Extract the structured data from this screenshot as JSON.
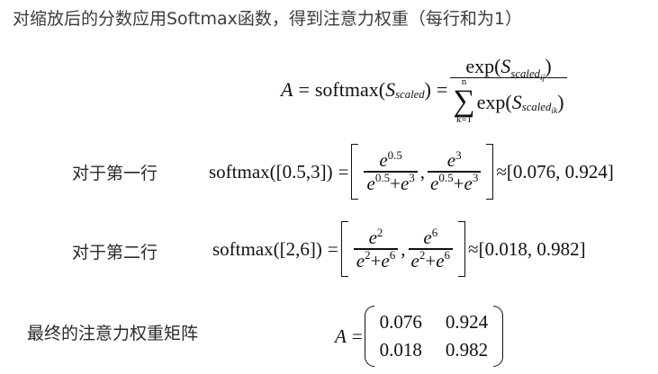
{
  "heading": "对缩放后的分数应用Softmax函数，得到注意力权重（每行和为1）",
  "formula": {
    "lhs": "A",
    "eq": "=",
    "fn": "softmax(",
    "S": "S",
    "scaled": "scaled",
    "close": ")",
    "num_fn": "exp(",
    "ij": "ij",
    "ik": "ik",
    "sum": "∑",
    "sum_top": "n",
    "sum_bottom": "k=1"
  },
  "row1": {
    "label": "对于第一行",
    "call": "softmax([0.5,3])",
    "eq": "=",
    "e": "e",
    "exp_a": "0.5",
    "exp_b": "3",
    "plus": "+",
    "comma": ",",
    "approx": "≈",
    "result": "[0.076, 0.924]"
  },
  "row2": {
    "label": "对于第二行",
    "call": "softmax([2,6])",
    "eq": "=",
    "e": "e",
    "exp_a": "2",
    "exp_b": "6",
    "plus": "+",
    "comma": ",",
    "approx": "≈",
    "result": "[0.018, 0.982]"
  },
  "final": {
    "label": "最终的注意力权重矩阵",
    "lhs": "A",
    "eq": "=",
    "m11": "0.076",
    "m12": "0.924",
    "m21": "0.018",
    "m22": "0.982"
  }
}
